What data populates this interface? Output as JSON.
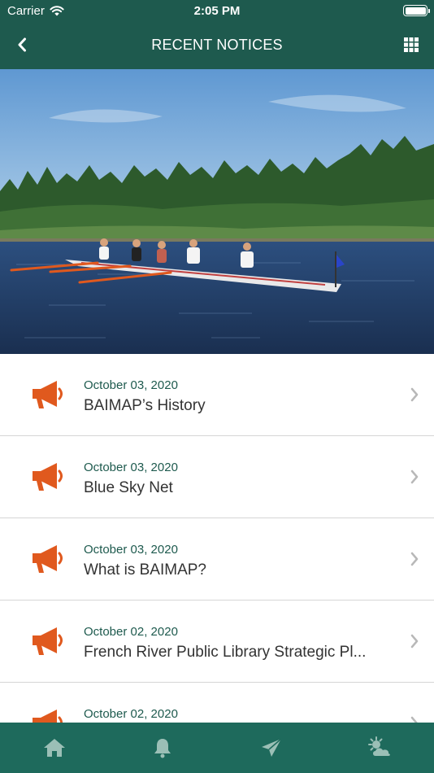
{
  "status_bar": {
    "carrier": "Carrier",
    "time": "2:05 PM"
  },
  "nav": {
    "title": "RECENT NOTICES",
    "back_icon": "chevron-left-icon",
    "menu_icon": "grid-icon"
  },
  "hero": {
    "icon": "rowing-photo"
  },
  "notices": [
    {
      "date": "October 03, 2020",
      "title": "BAIMAP’s History"
    },
    {
      "date": "October 03, 2020",
      "title": "Blue Sky Net"
    },
    {
      "date": "October 03, 2020",
      "title": "What is BAIMAP?"
    },
    {
      "date": "October 02, 2020",
      "title": "French River Public Library Strategic Pl..."
    },
    {
      "date": "October 02, 2020",
      "title": ""
    }
  ],
  "tab_bar": {
    "items": [
      {
        "icon": "home-icon"
      },
      {
        "icon": "bell-icon"
      },
      {
        "icon": "send-icon"
      },
      {
        "icon": "weather-icon"
      }
    ]
  },
  "colors": {
    "primary": "#1e5a4e",
    "tab_bar": "#1e6a5c",
    "accent": "#e0591e",
    "tab_icon": "#9bbfb6"
  }
}
